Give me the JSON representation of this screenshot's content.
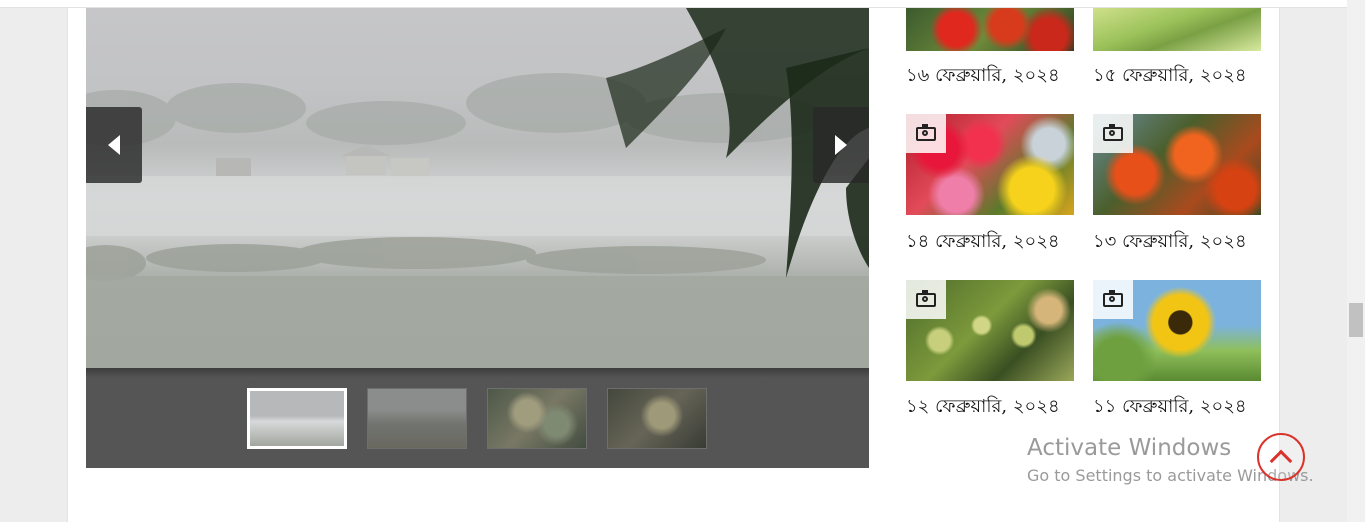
{
  "slider": {
    "icons": {
      "prev": "chevron-left-icon",
      "next": "chevron-right-icon"
    },
    "thumbnails": [
      {
        "label": "thumbnail-1",
        "active": true
      },
      {
        "label": "thumbnail-2",
        "active": false
      },
      {
        "label": "thumbnail-3",
        "active": false
      },
      {
        "label": "thumbnail-4",
        "active": false
      }
    ]
  },
  "gallery": {
    "items": [
      {
        "date": "১৬ ফেব্রুয়ারি, ২০২৪",
        "camera_icon": false
      },
      {
        "date": "১৫ ফেব্রুয়ারি, ২০২৪",
        "camera_icon": false
      },
      {
        "date": "১৪ ফেব্রুয়ারি, ২০২৪",
        "camera_icon": true
      },
      {
        "date": "১৩ ফেব্রুয়ারি, ২০২৪",
        "camera_icon": true
      },
      {
        "date": "১২ ফেব্রুয়ারি, ২০২৪",
        "camera_icon": true
      },
      {
        "date": "১১ ফেব্রুয়ারি, ২০২৪",
        "camera_icon": true
      }
    ],
    "icon": "camera-icon"
  },
  "overlay": {
    "activate_title": "Activate Windows",
    "activate_sub": "Go to Settings to activate Windows.",
    "accent_color": "#d9342b",
    "back_to_top_icon": "chevron-up-icon"
  }
}
